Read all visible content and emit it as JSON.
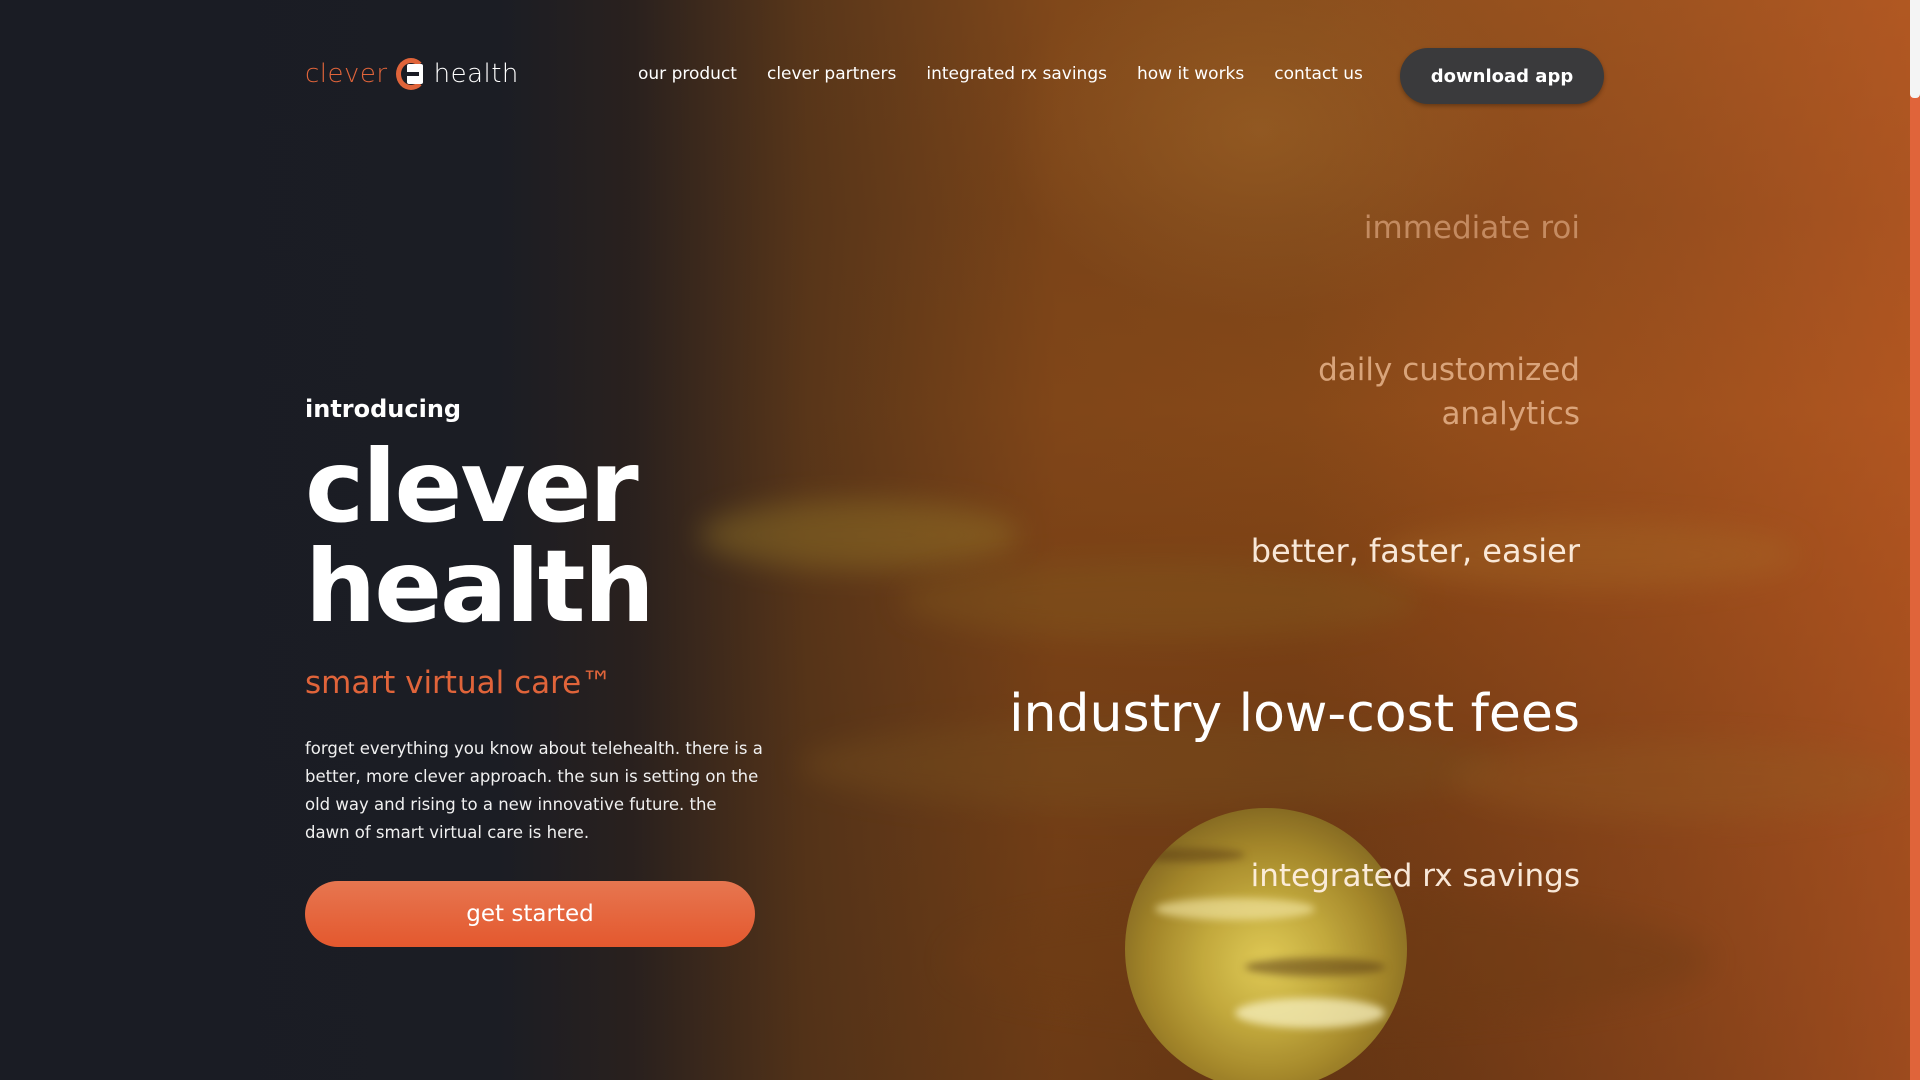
{
  "logo": {
    "clever": "clever",
    "health": "health"
  },
  "nav": {
    "items": [
      "our product",
      "clever partners",
      "integrated rx savings",
      "how it works",
      "contact us"
    ],
    "download_label": "download app"
  },
  "hero": {
    "intro": "introducing",
    "title_line1": "clever",
    "title_line2": "health",
    "tagline": "smart virtual care™",
    "description": "forget everything you know about telehealth. there is a better, more clever approach. the sun is setting on the old way and rising to a new innovative future. the dawn of smart virtual care is here.",
    "cta_label": "get started"
  },
  "features": [
    "immediate roi",
    "daily customized analytics",
    "better, faster, easier",
    "industry low-cost fees",
    "integrated rx savings"
  ],
  "colors": {
    "accent": "#e0643a",
    "background": "#1a1c24",
    "button_dark": "#3a3a3c"
  }
}
